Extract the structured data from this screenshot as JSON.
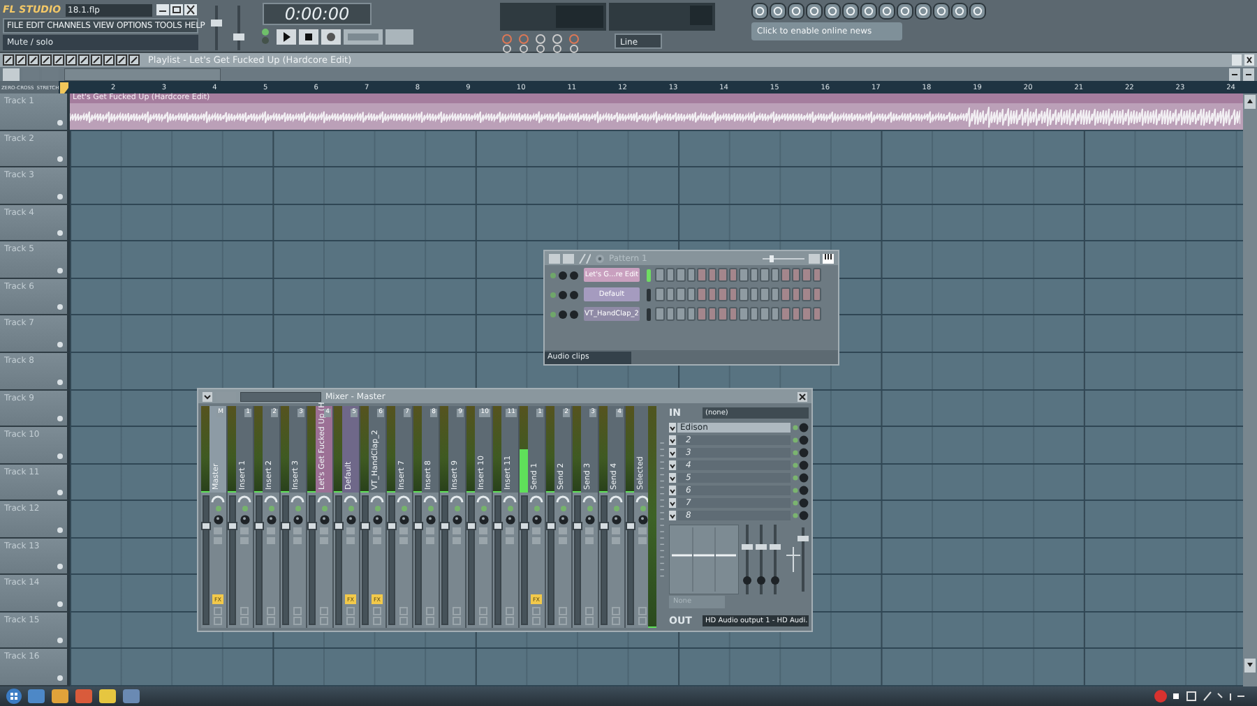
{
  "header": {
    "logo": "FL STUDIO",
    "file_name": "18.1.flp",
    "menu": [
      "FILE",
      "EDIT",
      "CHANNELS",
      "VIEW",
      "OPTIONS",
      "TOOLS",
      "HELP"
    ],
    "hint": "Mute / solo",
    "time": "0:00:00",
    "input_mode": "Line",
    "news": "Click to enable online news"
  },
  "playlist": {
    "title": "Playlist - Let's Get Fucked Up (Hardcore Edit)",
    "snap_options": [
      "ZERO-CROSS",
      "STRETCH"
    ],
    "ruler": [
      "2",
      "3",
      "4",
      "5",
      "6",
      "7",
      "8",
      "9",
      "10",
      "11",
      "12",
      "13",
      "14",
      "15",
      "16",
      "17",
      "18",
      "19",
      "20",
      "21",
      "22",
      "23",
      "24"
    ],
    "tracks": [
      {
        "name": "Track 1",
        "clip": "Let's Get Fucked Up (Hardcore Edit)"
      },
      {
        "name": "Track 2"
      },
      {
        "name": "Track 3"
      },
      {
        "name": "Track 4"
      },
      {
        "name": "Track 5"
      },
      {
        "name": "Track 6"
      },
      {
        "name": "Track 7"
      },
      {
        "name": "Track 8"
      },
      {
        "name": "Track 9"
      },
      {
        "name": "Track 10"
      },
      {
        "name": "Track 11"
      },
      {
        "name": "Track 12"
      },
      {
        "name": "Track 13"
      },
      {
        "name": "Track 14"
      },
      {
        "name": "Track 15"
      },
      {
        "name": "Track 16"
      }
    ]
  },
  "channel_rack": {
    "title": "Pattern 1",
    "filter": "Audio clips",
    "channels": [
      {
        "name": "Let's G...re Edit",
        "selected": true,
        "color": "#c9a0bf",
        "steps": [
          false,
          false,
          false,
          false,
          false,
          false,
          false,
          false,
          false,
          false,
          false,
          false,
          false,
          false,
          false,
          false
        ]
      },
      {
        "name": "Default",
        "selected": false,
        "color": "#a59bbf",
        "steps": [
          false,
          false,
          false,
          false,
          false,
          false,
          false,
          false,
          false,
          false,
          false,
          false,
          false,
          false,
          false,
          false
        ]
      },
      {
        "name": "VT_HandClap_2",
        "selected": false,
        "color": "#8f8aa6",
        "steps": [
          false,
          false,
          false,
          false,
          false,
          false,
          false,
          false,
          false,
          false,
          false,
          false,
          false,
          false,
          false,
          false
        ]
      }
    ]
  },
  "mixer": {
    "title": "Mixer - Master",
    "in_label": "IN",
    "input": "(none)",
    "slots": [
      "Edison",
      "2",
      "3",
      "4",
      "5",
      "6",
      "7",
      "8"
    ],
    "preset": "None",
    "out_label": "OUT",
    "output": "HD Audio output 1 - HD Audi.",
    "master_meter": {
      "level": 0
    },
    "strips": [
      {
        "name": "Master",
        "number": "M",
        "color": "#8d9ba5",
        "meter": {
          "level": 0
        },
        "fader": {
          "level": 0.8
        },
        "fx_badge": "FX"
      },
      {
        "name": "Insert 1",
        "number": "1",
        "color": "#5d6a73",
        "meter": {
          "level": 0
        },
        "fader": {
          "level": 0.8
        }
      },
      {
        "name": "Insert 2",
        "number": "2",
        "color": "#5d6a73",
        "meter": {
          "level": 0
        },
        "fader": {
          "level": 0.8
        }
      },
      {
        "name": "Insert 3",
        "number": "3",
        "color": "#5d6a73",
        "meter": {
          "level": 0
        },
        "fader": {
          "level": 0.8
        }
      },
      {
        "name": "Let's Get Fucked Up (H",
        "number": "4",
        "color": "#9c7095",
        "meter": {
          "level": 0
        },
        "fader": {
          "level": 0.8
        }
      },
      {
        "name": "Default",
        "number": "5",
        "color": "#6f6889",
        "meter": {
          "level": 0
        },
        "fader": {
          "level": 0.8
        },
        "fx_badge": "FX"
      },
      {
        "name": "VT_HandClap_2",
        "number": "6",
        "color": "#5d6a73",
        "meter": {
          "level": 0
        },
        "fader": {
          "level": 0.8
        },
        "fx_badge": "FX"
      },
      {
        "name": "Insert 7",
        "number": "7",
        "color": "#5d6a73",
        "meter": {
          "level": 0
        },
        "fader": {
          "level": 0.8
        }
      },
      {
        "name": "Insert 8",
        "number": "8",
        "color": "#5d6a73",
        "meter": {
          "level": 0
        },
        "fader": {
          "level": 0.8
        }
      },
      {
        "name": "Insert 9",
        "number": "9",
        "color": "#5d6a73",
        "meter": {
          "level": 0
        },
        "fader": {
          "level": 0.8
        }
      },
      {
        "name": "Insert 10",
        "number": "10",
        "color": "#5d6a73",
        "meter": {
          "level": 0
        },
        "fader": {
          "level": 0.8
        }
      },
      {
        "name": "Insert 11",
        "number": "11",
        "color": "#5d6a73",
        "meter": {
          "level": 0
        },
        "fader": {
          "level": 0.8
        }
      },
      {
        "name": "Send 1",
        "number": "1",
        "color": "#5d6a73",
        "meter": {
          "level": 0.5
        },
        "fader": {
          "level": 0.8
        },
        "fx_badge": "FX"
      },
      {
        "name": "Send 2",
        "number": "2",
        "color": "#5d6a73",
        "meter": {
          "level": 0
        },
        "fader": {
          "level": 0.8
        }
      },
      {
        "name": "Send 3",
        "number": "3",
        "color": "#5d6a73",
        "meter": {
          "level": 0
        },
        "fader": {
          "level": 0.8
        }
      },
      {
        "name": "Send 4",
        "number": "4",
        "color": "#5d6a73",
        "meter": {
          "level": 0
        },
        "fader": {
          "level": 0.8
        }
      },
      {
        "name": "Selected",
        "color": "#5d6a73",
        "meter": {
          "level": 0
        },
        "fader": {
          "level": 0.8
        }
      }
    ]
  }
}
